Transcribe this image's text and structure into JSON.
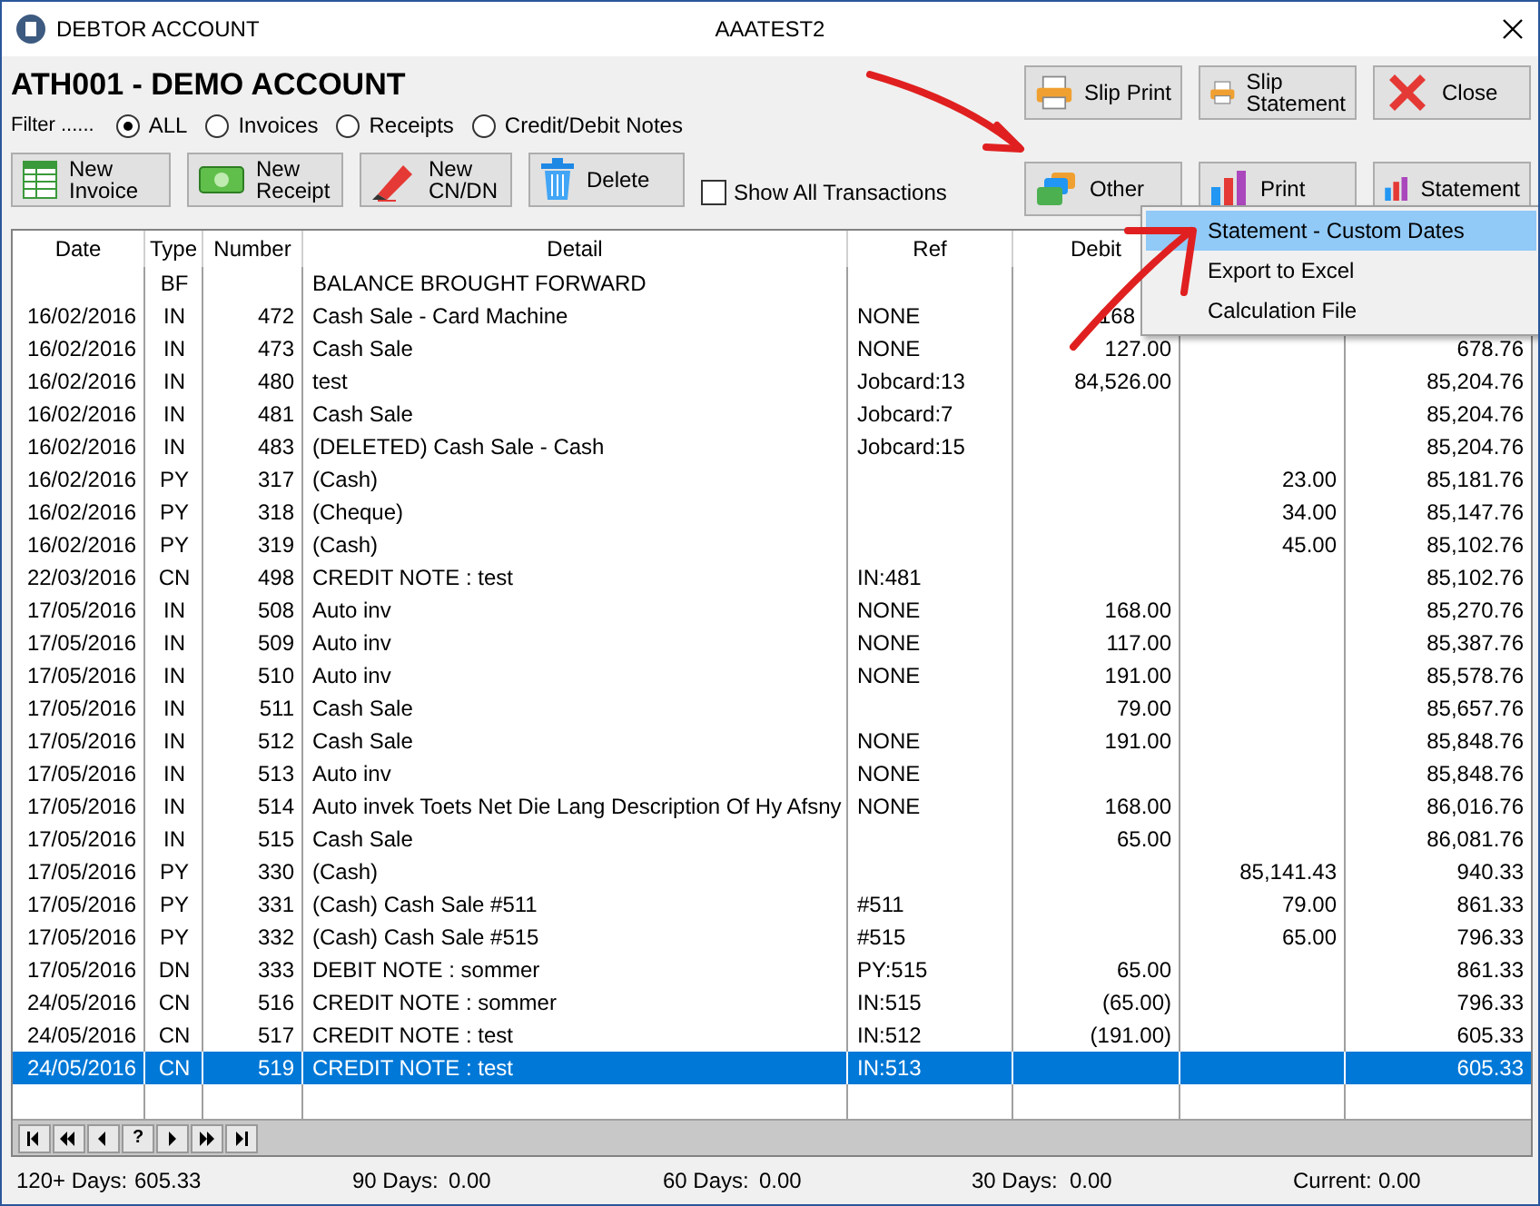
{
  "window": {
    "title": "DEBTOR ACCOUNT",
    "company": "AAATEST2"
  },
  "account_title": "ATH001 - DEMO ACCOUNT",
  "filter": {
    "label": "Filter ......",
    "options": [
      {
        "label": "ALL",
        "selected": true
      },
      {
        "label": "Invoices",
        "selected": false
      },
      {
        "label": "Receipts",
        "selected": false
      },
      {
        "label": "Credit/Debit Notes",
        "selected": false
      }
    ]
  },
  "actions": [
    {
      "kind": "invoice",
      "label": "New\nInvoice"
    },
    {
      "kind": "receipt",
      "label": "New\nReceipt"
    },
    {
      "kind": "note",
      "label": "New\nCN/DN"
    },
    {
      "kind": "delete",
      "label": "Delete"
    }
  ],
  "show_all": {
    "label": "Show All Transactions",
    "checked": false
  },
  "right_buttons": [
    {
      "kind": "printer",
      "label": "Slip Print"
    },
    {
      "kind": "printer",
      "label": "Slip\nStatement"
    },
    {
      "kind": "close",
      "label": "Close"
    },
    {
      "kind": "other",
      "label": "Other"
    },
    {
      "kind": "chart",
      "label": "Print"
    },
    {
      "kind": "chart",
      "label": "Statement"
    }
  ],
  "table": {
    "columns": [
      "Date",
      "Type",
      "Number",
      "Detail",
      "Ref",
      "Debit"
    ],
    "rows": [
      {
        "date": "",
        "type": "BF",
        "number": "",
        "detail": "BALANCE BROUGHT FORWARD",
        "ref": "",
        "selected": false
      },
      {
        "date": "16/02/2016",
        "type": "IN",
        "number": "472",
        "detail": "Cash Sale - Card Machine",
        "ref": "NONE",
        "debit": "168",
        "debit_partial": true,
        "selected": false
      },
      {
        "date": "16/02/2016",
        "type": "IN",
        "number": "473",
        "detail": "Cash Sale",
        "ref": "NONE",
        "debit": "127.00",
        "balance": "678.76",
        "selected": false
      },
      {
        "date": "16/02/2016",
        "type": "IN",
        "number": "480",
        "detail": "test",
        "ref": "Jobcard:13",
        "debit": "84,526.00",
        "balance": "85,204.76",
        "selected": false
      },
      {
        "date": "16/02/2016",
        "type": "IN",
        "number": "481",
        "detail": "Cash Sale",
        "ref": "Jobcard:7",
        "balance": "85,204.76",
        "selected": false
      },
      {
        "date": "16/02/2016",
        "type": "IN",
        "number": "483",
        "detail": "(DELETED) Cash Sale - Cash",
        "ref": "Jobcard:15",
        "balance": "85,204.76",
        "selected": false
      },
      {
        "date": "16/02/2016",
        "type": "PY",
        "number": "317",
        "detail": "(Cash)",
        "ref": "",
        "credit": "23.00",
        "balance": "85,181.76",
        "selected": false
      },
      {
        "date": "16/02/2016",
        "type": "PY",
        "number": "318",
        "detail": "(Cheque)",
        "ref": "",
        "credit": "34.00",
        "balance": "85,147.76",
        "selected": false
      },
      {
        "date": "16/02/2016",
        "type": "PY",
        "number": "319",
        "detail": "(Cash)",
        "ref": "",
        "credit": "45.00",
        "balance": "85,102.76",
        "selected": false
      },
      {
        "date": "22/03/2016",
        "type": "CN",
        "number": "498",
        "detail": "CREDIT NOTE : test",
        "ref": "IN:481",
        "balance": "85,102.76",
        "selected": false
      },
      {
        "date": "17/05/2016",
        "type": "IN",
        "number": "508",
        "detail": "Auto inv",
        "ref": "NONE",
        "debit": "168.00",
        "balance": "85,270.76",
        "selected": false
      },
      {
        "date": "17/05/2016",
        "type": "IN",
        "number": "509",
        "detail": "Auto inv",
        "ref": "NONE",
        "debit": "117.00",
        "balance": "85,387.76",
        "selected": false
      },
      {
        "date": "17/05/2016",
        "type": "IN",
        "number": "510",
        "detail": "Auto inv",
        "ref": "NONE",
        "debit": "191.00",
        "balance": "85,578.76",
        "selected": false
      },
      {
        "date": "17/05/2016",
        "type": "IN",
        "number": "511",
        "detail": "Cash Sale",
        "ref": "",
        "debit": "79.00",
        "balance": "85,657.76",
        "selected": false
      },
      {
        "date": "17/05/2016",
        "type": "IN",
        "number": "512",
        "detail": "Cash Sale",
        "ref": "NONE",
        "debit": "191.00",
        "balance": "85,848.76",
        "selected": false
      },
      {
        "date": "17/05/2016",
        "type": "IN",
        "number": "513",
        "detail": "Auto inv",
        "ref": "NONE",
        "balance": "85,848.76",
        "selected": false
      },
      {
        "date": "17/05/2016",
        "type": "IN",
        "number": "514",
        "detail": "Auto invek Toets Net Die Lang Description Of Hy Afsny",
        "ref": "NONE",
        "debit": "168.00",
        "balance": "86,016.76",
        "selected": false
      },
      {
        "date": "17/05/2016",
        "type": "IN",
        "number": "515",
        "detail": "Cash Sale",
        "ref": "",
        "debit": "65.00",
        "balance": "86,081.76",
        "selected": false
      },
      {
        "date": "17/05/2016",
        "type": "PY",
        "number": "330",
        "detail": "(Cash)",
        "ref": "",
        "credit": "85,141.43",
        "balance": "940.33",
        "selected": false
      },
      {
        "date": "17/05/2016",
        "type": "PY",
        "number": "331",
        "detail": "(Cash) Cash Sale #511",
        "ref": "#511",
        "credit": "79.00",
        "balance": "861.33",
        "selected": false
      },
      {
        "date": "17/05/2016",
        "type": "PY",
        "number": "332",
        "detail": "(Cash) Cash Sale #515",
        "ref": "#515",
        "credit": "65.00",
        "balance": "796.33",
        "selected": false
      },
      {
        "date": "17/05/2016",
        "type": "DN",
        "number": "333",
        "detail": "DEBIT NOTE : sommer",
        "ref": "PY:515",
        "debit": "65.00",
        "balance": "861.33",
        "selected": false
      },
      {
        "date": "24/05/2016",
        "type": "CN",
        "number": "516",
        "detail": "CREDIT NOTE : sommer",
        "ref": "IN:515",
        "debit": "(65.00)",
        "balance": "796.33",
        "selected": false
      },
      {
        "date": "24/05/2016",
        "type": "CN",
        "number": "517",
        "detail": "CREDIT NOTE : test",
        "ref": "IN:512",
        "debit": "(191.00)",
        "balance": "605.33",
        "selected": false
      },
      {
        "date": "24/05/2016",
        "type": "CN",
        "number": "519",
        "detail": "CREDIT NOTE : test",
        "ref": "IN:513",
        "balance": "605.33",
        "selected": true
      }
    ]
  },
  "navigator": [
    {
      "kind": "first"
    },
    {
      "kind": "prev-page"
    },
    {
      "kind": "prev"
    },
    {
      "kind": "help",
      "label": "?"
    },
    {
      "kind": "next"
    },
    {
      "kind": "next-page"
    },
    {
      "kind": "last"
    }
  ],
  "aging": [
    {
      "label": "120+ Days:",
      "value": "605.33"
    },
    {
      "label": "90 Days:",
      "value": "0.00"
    },
    {
      "label": "60 Days:",
      "value": "0.00"
    },
    {
      "label": "30 Days:",
      "value": "0.00"
    },
    {
      "label": "Current:",
      "value": "0.00"
    }
  ],
  "context_menu": [
    {
      "label": "Statement - Custom Dates",
      "selected": true
    },
    {
      "label": "Export to Excel",
      "selected": false
    },
    {
      "label": "Calculation File",
      "selected": false
    }
  ]
}
